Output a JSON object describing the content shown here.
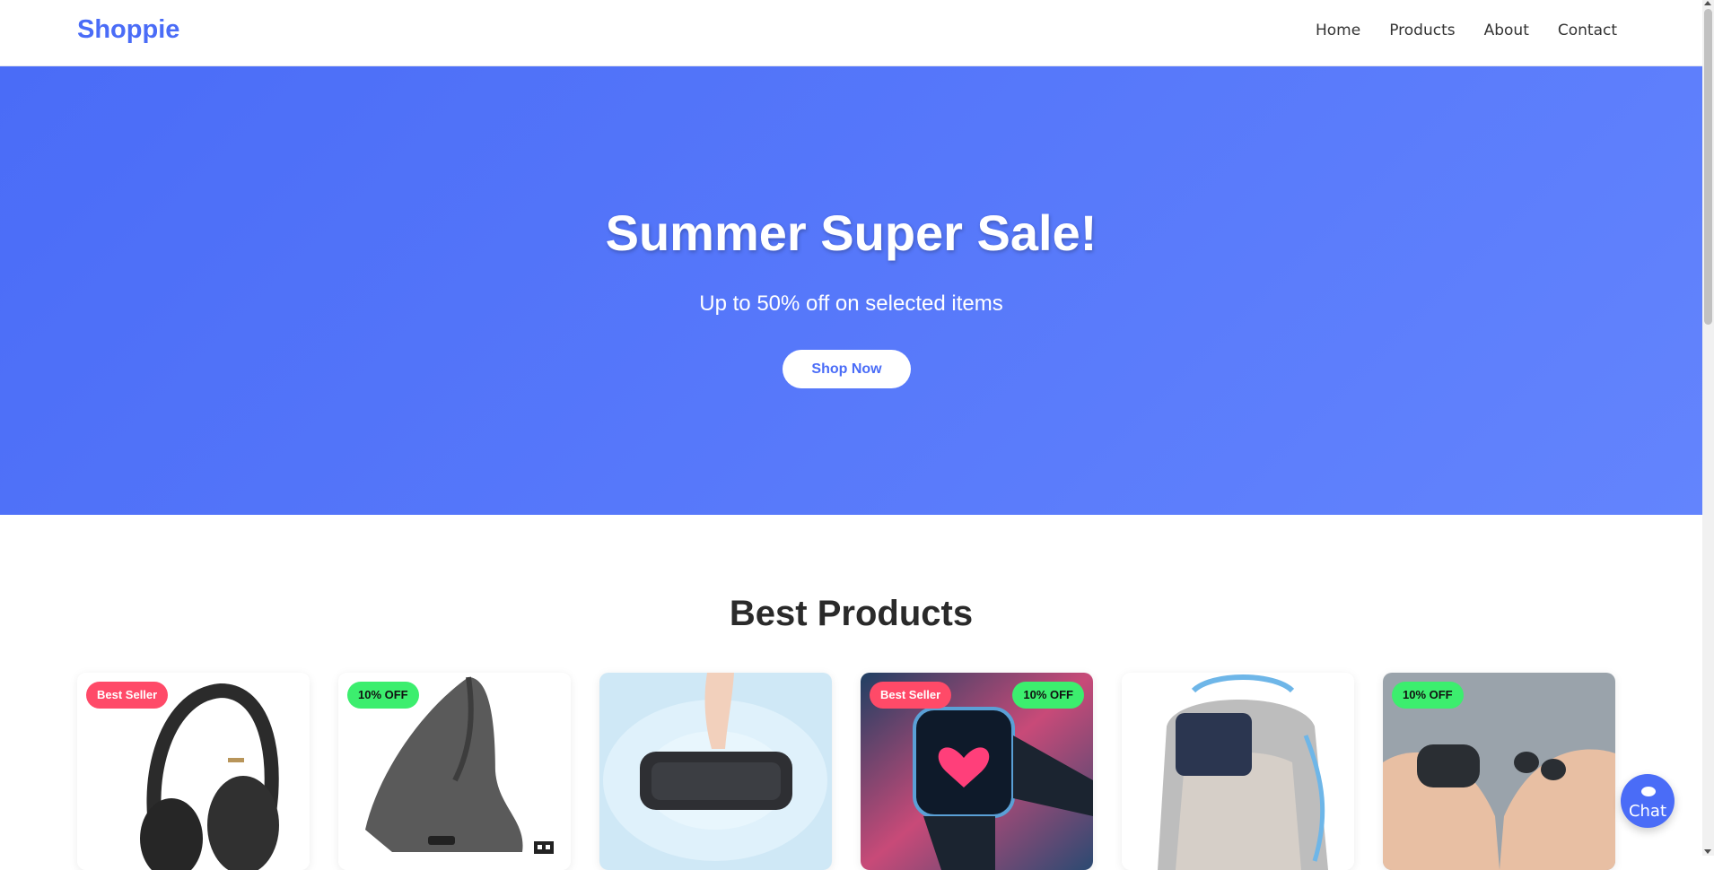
{
  "brand": {
    "name": "Shoppie",
    "color": "#4a6cf7"
  },
  "nav": {
    "items": [
      {
        "label": "Home"
      },
      {
        "label": "Products"
      },
      {
        "label": "About"
      },
      {
        "label": "Contact"
      }
    ]
  },
  "hero": {
    "title": "Summer Super Sale!",
    "subtitle": "Up to 50% off on selected items",
    "cta": "Shop Now",
    "gradient": [
      "#4a6cf7",
      "#6384fd"
    ]
  },
  "products_section": {
    "title": "Best Products",
    "products": [
      {
        "image": "headphones",
        "badges": [
          "Best Seller"
        ]
      },
      {
        "image": "vertical-mouse",
        "badges": [
          "10% OFF"
        ]
      },
      {
        "image": "bluetooth-speaker",
        "badges": []
      },
      {
        "image": "smartwatch",
        "badges": [
          "Best Seller",
          "10% OFF"
        ]
      },
      {
        "image": "backpack",
        "badges": []
      },
      {
        "image": "wireless-earbuds",
        "badges": [
          "10% OFF"
        ]
      }
    ]
  },
  "badges": {
    "best_seller": {
      "label": "Best Seller",
      "color": "#ff4a68"
    },
    "discount": {
      "label": "10% OFF",
      "color": "#3cee6e"
    }
  },
  "chat": {
    "label": "Chat",
    "icon": "chat-bubble-icon"
  }
}
